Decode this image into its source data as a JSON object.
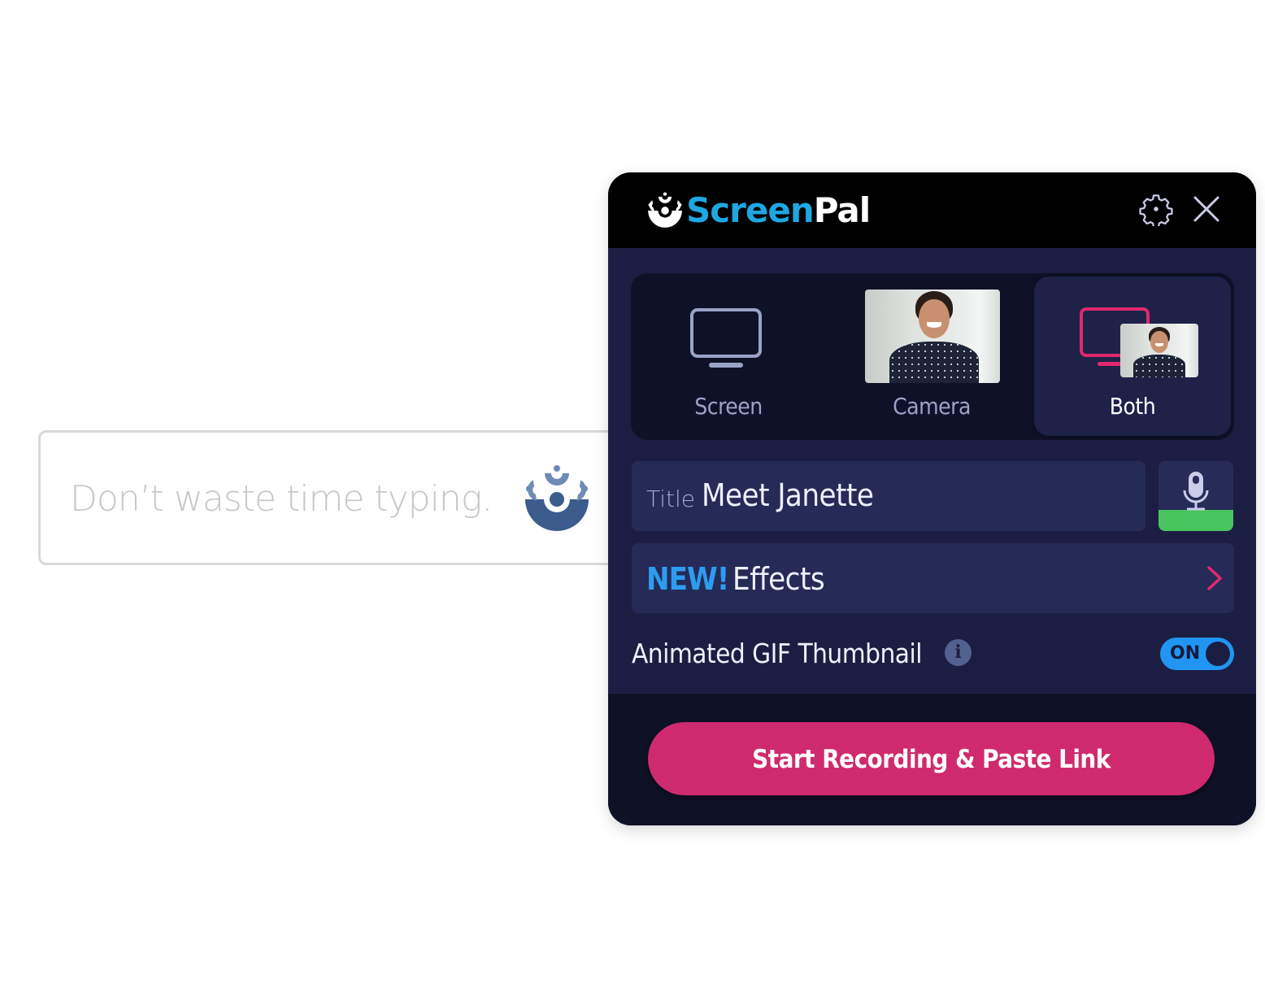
{
  "background_field": {
    "placeholder": "Don’t waste time typing.",
    "icon": "screenpal-logo-icon"
  },
  "panel": {
    "header": {
      "brand_part1": "Screen",
      "brand_part2": "Pal",
      "icons": [
        "screenpal-logo-icon",
        "gear-icon",
        "close-icon"
      ]
    },
    "modes": [
      {
        "label": "Screen",
        "icon": "monitor-icon",
        "selected": false
      },
      {
        "label": "Camera",
        "icon": "camera-preview",
        "selected": false
      },
      {
        "label": "Both",
        "icon": "monitor-with-camera-icon",
        "selected": true
      }
    ],
    "title_field": {
      "label": "Title",
      "value": "Meet Janette"
    },
    "mic": {
      "icon": "microphone-icon",
      "status_color": "#47c45e"
    },
    "effects": {
      "badge": "NEW!",
      "label": "Effects",
      "icon": "chevron-right-icon"
    },
    "gif_thumbnail": {
      "label": "Animated GIF Thumbnail",
      "info_icon": "info-icon",
      "toggle_state": "ON",
      "enabled": true
    },
    "cta": {
      "label": "Start Recording & Paste Link"
    }
  },
  "colors": {
    "brand_blue": "#1ea7e1",
    "accent_pink": "#d02a6e",
    "toggle_blue": "#2195f2",
    "new_blue": "#2d9cf0",
    "panel_bg": "#1b1e42",
    "header_bg": "#000000"
  }
}
